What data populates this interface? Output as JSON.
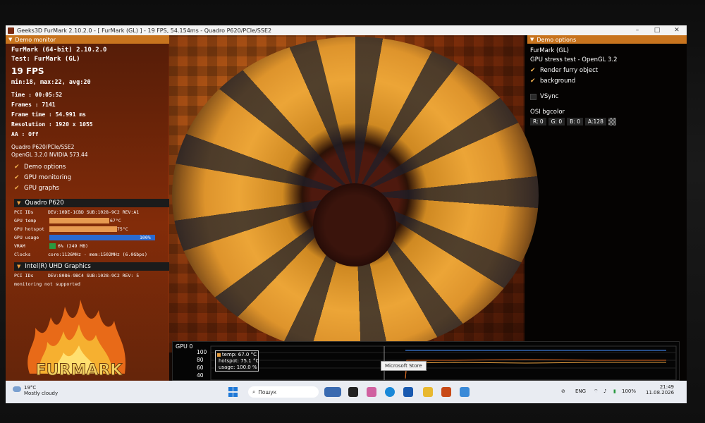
{
  "window": {
    "title": "Geeks3D FurMark 2.10.2.0 - [ FurMark (GL) ] - 19 FPS, 54.154ms - Quadro P620/PCIe/SSE2",
    "minimize": "–",
    "maximize": "□",
    "close": "✕"
  },
  "demo_monitor": {
    "header": "Demo monitor",
    "app_version": "FurMark (64-bit) 2.10.2.0",
    "test": "Test: FurMark (GL)",
    "fps": "19 FPS",
    "fps_stats": "min:18, max:22, avg:20",
    "time": "Time        : 00:05:52",
    "frames": "Frames      : 7141",
    "frame_time": "Frame time  : 54.991 ms",
    "resolution": "Resolution  : 1920 x 1055",
    "aa": "AA          : Off",
    "renderer": "Quadro P620/PCIe/SSE2",
    "opengl": "OpenGL 3.2.0 NVIDIA 573.44",
    "checks": [
      {
        "label": "Demo options"
      },
      {
        "label": "GPU monitoring"
      },
      {
        "label": "GPU graphs"
      }
    ]
  },
  "gpu0": {
    "header": "Quadro P620",
    "pci_label": "PCI IDs",
    "pci_value": "DEV:10DE-1CBD SUB:1028-9C2 REV:A1",
    "temp_label": "GPU temp",
    "temp_value": "67°C",
    "temp_fraction": 0.67,
    "hotspot_label": "GPU hotspot",
    "hotspot_value": "75°C",
    "hotspot_fraction": 0.75,
    "usage_label": "GPU usage",
    "usage_value": "100%",
    "usage_fraction": 1.0,
    "vram_label": "VRAM",
    "vram_value": "6% (249 MB)",
    "vram_fraction": 0.06,
    "clocks_label": "Clocks",
    "clocks_value": "core:1126MHz - mem:1502MHz (6.0Gbps)"
  },
  "gpu1": {
    "header": "Intel(R) UHD Graphics",
    "pci_label": "PCI IDs",
    "pci_value": "DEV:8086-9BC4 SUB:1028-9C2 REV: 5",
    "note": "monitoring not supported"
  },
  "logo_text": "FURMARK",
  "demo_options": {
    "header": "Demo options",
    "name": "FurMark (GL)",
    "description": "GPU stress test - OpenGL 3.2",
    "render_furry": "Render furry object",
    "background": "background",
    "vsync": "VSync",
    "osi_label": "OSI bgcolor",
    "r": "R: 0",
    "g": "G: 0",
    "b": "B: 0",
    "a": "A:128"
  },
  "graph": {
    "title": "GPU 0",
    "yticks": [
      "100",
      "80",
      "60",
      "40"
    ],
    "legend": [
      {
        "label": "temp: 67.0 °C",
        "color": "#e8a040"
      },
      {
        "label": "hotspot: 75.1 °C",
        "color": "#e06820"
      },
      {
        "label": "usage: 100.0 %",
        "color": "#3a7ad8"
      }
    ],
    "tooltip": "Microsoft Store"
  },
  "taskbar": {
    "weather_temp": "19°C",
    "weather_desc": "Mostly cloudy",
    "search": "Пошук",
    "lang": "ENG",
    "battery": "100%",
    "time": "21:49",
    "date": "11.08.2026"
  },
  "colors": {
    "accent": "#c8741e",
    "usage_bar": "#2a6ad0",
    "temp_bar": "#e89a50",
    "vram_bar": "#2a9a40"
  }
}
